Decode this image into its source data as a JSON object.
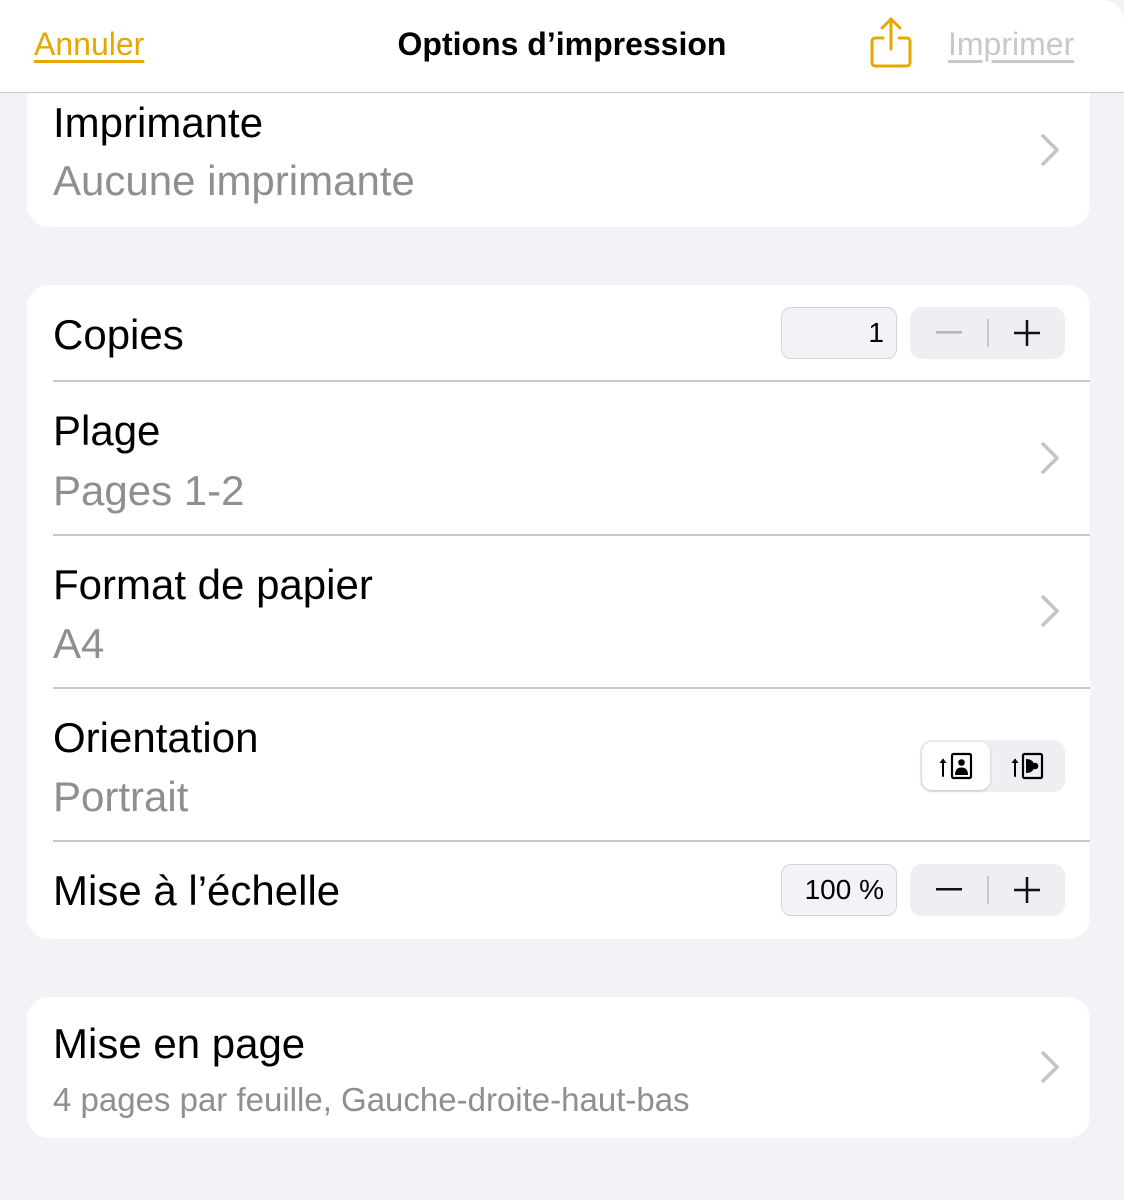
{
  "navbar": {
    "cancel_label": "Annuler",
    "title": "Options d’impression",
    "share_icon": "share-icon",
    "print_label": "Imprimer"
  },
  "colors": {
    "accent": "#e6a800",
    "background": "#f2f2f7",
    "disabled": "#c7c7cc",
    "secondary_text": "#8e8e93"
  },
  "printer": {
    "label": "Imprimante",
    "value": "Aucune imprimante"
  },
  "copies": {
    "label": "Copies",
    "value": "1",
    "minus": "−",
    "plus": "+"
  },
  "range": {
    "label": "Plage",
    "value": "Pages 1-2"
  },
  "paper": {
    "label": "Format de papier",
    "value": "A4"
  },
  "orientation": {
    "label": "Orientation",
    "value": "Portrait",
    "options": [
      "portrait",
      "landscape"
    ],
    "selected": "portrait"
  },
  "scale": {
    "label": "Mise à l’échelle",
    "value": "100 %",
    "minus": "−",
    "plus": "+"
  },
  "layout": {
    "label": "Mise en page",
    "value": "4 pages par feuille, Gauche-droite-haut-bas"
  }
}
